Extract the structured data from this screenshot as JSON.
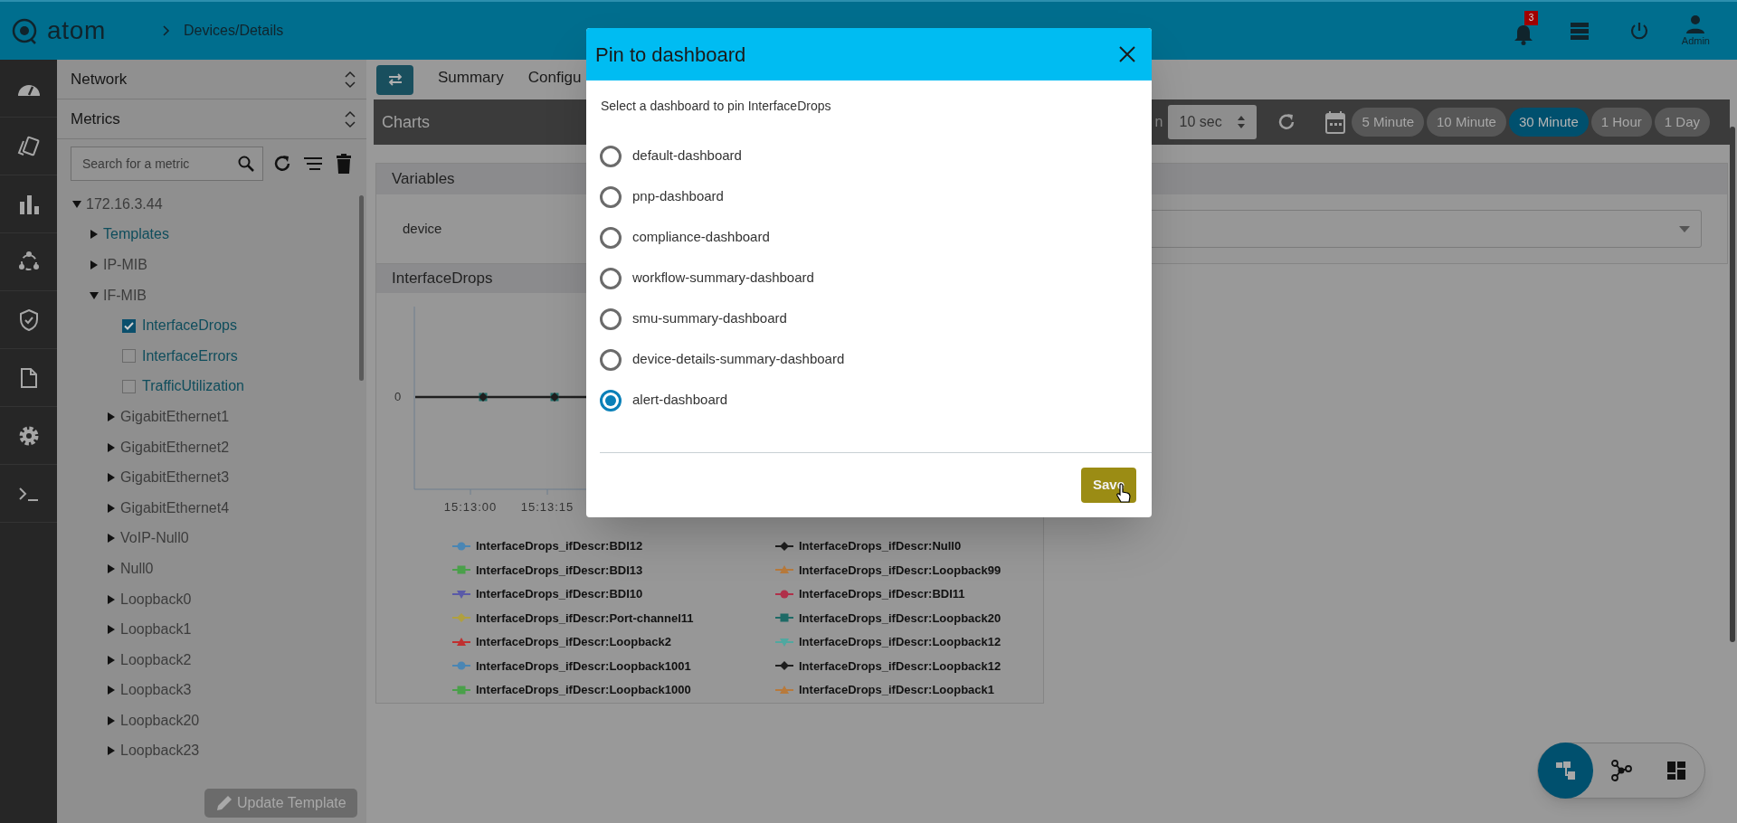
{
  "header": {
    "logo": "atom",
    "breadcrumb": "Devices/Details",
    "notification_count": "3",
    "user": "Admin"
  },
  "sidebar": {
    "sections": [
      {
        "label": "Network"
      },
      {
        "label": "Metrics"
      }
    ],
    "search": {
      "placeholder": "Search for a metric"
    },
    "tree": [
      {
        "label": "172.16.3.44",
        "kind": "folder",
        "expanded": true,
        "children": [
          {
            "label": "Templates",
            "kind": "template-folder",
            "expanded": false
          },
          {
            "label": "IP-MIB",
            "kind": "folder",
            "expanded": false
          },
          {
            "label": "IF-MIB",
            "kind": "folder",
            "expanded": true,
            "children": [
              {
                "label": "InterfaceDrops",
                "kind": "metric",
                "checked": true
              },
              {
                "label": "InterfaceErrors",
                "kind": "metric",
                "checked": false
              },
              {
                "label": "TrafficUtilization",
                "kind": "metric",
                "checked": false
              },
              {
                "label": "GigabitEthernet1",
                "kind": "folder",
                "expanded": false
              },
              {
                "label": "GigabitEthernet2",
                "kind": "folder",
                "expanded": false
              },
              {
                "label": "GigabitEthernet3",
                "kind": "folder",
                "expanded": false
              },
              {
                "label": "GigabitEthernet4",
                "kind": "folder",
                "expanded": false
              },
              {
                "label": "VoIP-Null0",
                "kind": "folder",
                "expanded": false
              },
              {
                "label": "Null0",
                "kind": "folder",
                "expanded": false
              },
              {
                "label": "Loopback0",
                "kind": "folder",
                "expanded": false
              },
              {
                "label": "Loopback1",
                "kind": "folder",
                "expanded": false
              },
              {
                "label": "Loopback2",
                "kind": "folder",
                "expanded": false
              },
              {
                "label": "Loopback3",
                "kind": "folder",
                "expanded": false
              },
              {
                "label": "Loopback20",
                "kind": "folder",
                "expanded": false
              },
              {
                "label": "Loopback23",
                "kind": "folder",
                "expanded": false
              }
            ]
          }
        ]
      }
    ],
    "update_button": "Update Template"
  },
  "tabs": [
    {
      "label": "Summary",
      "selected": false
    },
    {
      "label": "Configu",
      "selected": false
    }
  ],
  "charts_toolbar": {
    "title": "Charts",
    "refresh_label": "n",
    "interval": "10 sec",
    "ranges": [
      {
        "label": "5 Minute",
        "selected": false
      },
      {
        "label": "10 Minute",
        "selected": false
      },
      {
        "label": "30 Minute",
        "selected": true
      },
      {
        "label": "1 Hour",
        "selected": false
      },
      {
        "label": "1 Day",
        "selected": false
      }
    ]
  },
  "variables": {
    "title": "Variables",
    "rows": [
      {
        "label": "device"
      }
    ]
  },
  "chart_panel": {
    "title": "InterfaceDrops",
    "y_label": "0",
    "x_labels": [
      "15:13:00",
      "15:13:15"
    ],
    "legend": [
      {
        "name": "InterfaceDrops_ifDescr:BDI12",
        "color": "#4a86b4",
        "kind": "circle"
      },
      {
        "name": "InterfaceDrops_ifDescr:Null0",
        "color": "#1e1e1e",
        "kind": "diamond"
      },
      {
        "name": "InterfaceDrops_ifDescr:BDI13",
        "color": "#4aa04a",
        "kind": "square"
      },
      {
        "name": "InterfaceDrops_ifDescr:Loopback99",
        "color": "#b87a3c",
        "kind": "triangle"
      },
      {
        "name": "InterfaceDrops_ifDescr:BDI10",
        "color": "#5a5aa8",
        "kind": "triangle-down"
      },
      {
        "name": "InterfaceDrops_ifDescr:BDI11",
        "color": "#b0304a",
        "kind": "circle"
      },
      {
        "name": "InterfaceDrops_ifDescr:Port-channel11",
        "color": "#b0a040",
        "kind": "diamond"
      },
      {
        "name": "InterfaceDrops_ifDescr:Loopback20",
        "color": "#1e6a66",
        "kind": "square"
      },
      {
        "name": "InterfaceDrops_ifDescr:Loopback2",
        "color": "#c03030",
        "kind": "triangle"
      },
      {
        "name": "InterfaceDrops_ifDescr:Loopback12",
        "color": "#50a8a0",
        "kind": "triangle-down"
      },
      {
        "name": "InterfaceDrops_ifDescr:Loopback1001",
        "color": "#4a86b4",
        "kind": "circle"
      },
      {
        "name": "InterfaceDrops_ifDescr:Loopback12",
        "color": "#1e1e1e",
        "kind": "diamond"
      },
      {
        "name": "InterfaceDrops_ifDescr:Loopback1000",
        "color": "#4aa04a",
        "kind": "square"
      },
      {
        "name": "InterfaceDrops_ifDescr:Loopback1",
        "color": "#b87a3c",
        "kind": "triangle"
      }
    ]
  },
  "view_switcher": [
    {
      "kind": "tree",
      "selected": true
    },
    {
      "kind": "graph",
      "selected": false
    },
    {
      "kind": "grid",
      "selected": false
    }
  ],
  "dialog": {
    "title": "Pin to dashboard",
    "prompt": "Select a dashboard to pin InterfaceDrops",
    "options": [
      {
        "label": "default-dashboard",
        "selected": false
      },
      {
        "label": "pnp-dashboard",
        "selected": false
      },
      {
        "label": "compliance-dashboard",
        "selected": false
      },
      {
        "label": "workflow-summary-dashboard",
        "selected": false
      },
      {
        "label": "smu-summary-dashboard",
        "selected": false
      },
      {
        "label": "device-details-summary-dashboard",
        "selected": false
      },
      {
        "label": "alert-dashboard",
        "selected": true
      }
    ],
    "save": "Save"
  }
}
